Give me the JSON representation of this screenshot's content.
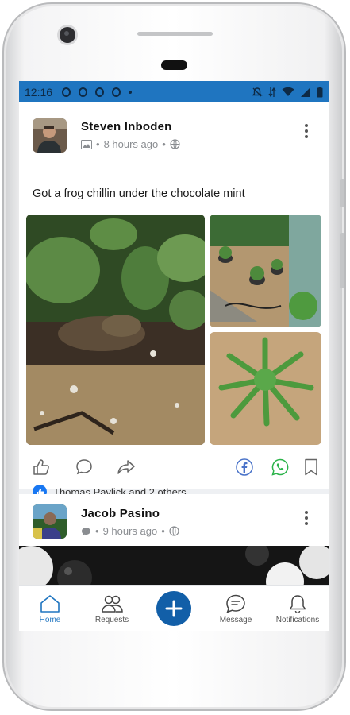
{
  "status_bar": {
    "time": "12:16"
  },
  "post1": {
    "author": "Steven  Inboden",
    "time_ago": "8 hours ago",
    "text": "Got a frog chillin under the chocolate mint",
    "likes_text": "Thomas Pavlick and 2 others"
  },
  "post2": {
    "author": "Jacob Pasino",
    "time_ago": "9 hours ago"
  },
  "nav": {
    "home": "Home",
    "requests": "Requests",
    "message": "Message",
    "notifications": "Notifications"
  },
  "colors": {
    "brand_blue": "#1f75c0",
    "fab_blue": "#125fa8",
    "like_blue": "#1877f2"
  }
}
